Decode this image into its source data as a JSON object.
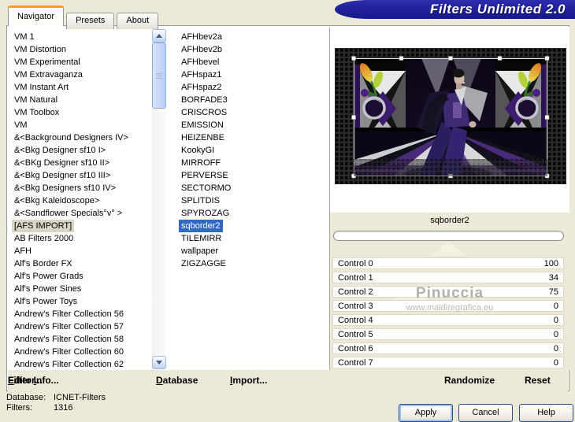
{
  "window": {
    "title": "Filters Unlimited 2.0"
  },
  "tabs": {
    "items": [
      "Navigator",
      "Presets",
      "About"
    ],
    "selected_index": 0
  },
  "category_list": {
    "selected_index": 15,
    "items": [
      "VM 1",
      "VM Distortion",
      "VM Experimental",
      "VM Extravaganza",
      "VM Instant Art",
      "VM Natural",
      "VM Toolbox",
      "VM",
      "&<Background Designers IV>",
      "&<Bkg Designer sf10 I>",
      "&<BKg Designer sf10 II>",
      "&<Bkg Designer sf10 III>",
      "&<Bkg Designers sf10 IV>",
      "&<Bkg Kaleidoscope>",
      "&<Sandflower Specials°v° >",
      "[AFS IMPORT]",
      "AB Filters 2000",
      "AFH",
      "Alf's Border FX",
      "Alf's Power Grads",
      "Alf's Power Sines",
      "Alf's Power Toys",
      "Andrew's Filter Collection 56",
      "Andrew's Filter Collection 57",
      "Andrew's Filter Collection 58",
      "Andrew's Filter Collection 60",
      "Andrew's Filter Collection 62"
    ]
  },
  "filter_list": {
    "selected_index": 15,
    "items": [
      "AFHbev2a",
      "AFHbev2b",
      "AFHbevel",
      "AFHspaz1",
      "AFHspaz2",
      "BORFADE3",
      "CRISCROS",
      "EMISSION",
      "HEIZENBE",
      "KookyGI",
      "MIRROFF",
      "PERVERSE",
      "SECTORMO",
      "SPLITDIS",
      "SPYROZAG",
      "sqborder2",
      "TILEMIRR",
      "wallpaper",
      "ZIGZAGGE"
    ]
  },
  "preview": {
    "filter_name": "sqborder2"
  },
  "controls": [
    {
      "label": "Control 0",
      "value": "100"
    },
    {
      "label": "Control 1",
      "value": "34"
    },
    {
      "label": "Control 2",
      "value": "75"
    },
    {
      "label": "Control 3",
      "value": "0"
    },
    {
      "label": "Control 4",
      "value": "0"
    },
    {
      "label": "Control 5",
      "value": "0"
    },
    {
      "label": "Control 6",
      "value": "0"
    },
    {
      "label": "Control 7",
      "value": "0"
    }
  ],
  "watermark": {
    "line1": "Pinuccia",
    "line2": "www.maidiregrafica.eu"
  },
  "toolbar": {
    "items": [
      {
        "pre": "",
        "key": "D",
        "post": "atabase"
      },
      {
        "pre": "",
        "key": "I",
        "post": "mport..."
      },
      {
        "pre": "Filter ",
        "key": "I",
        "post": "nfo..."
      },
      {
        "pre": "",
        "key": "E",
        "post": "ditor..."
      }
    ],
    "randomize_label": "Randomize",
    "reset_label": "Reset"
  },
  "status": {
    "rows": [
      {
        "label": "Database:",
        "value": "ICNET-Filters"
      },
      {
        "label": "Filters:",
        "value": "1316"
      }
    ]
  },
  "actions": {
    "apply": "Apply",
    "cancel": "Cancel",
    "help": "Help"
  },
  "colors": {
    "dialog_beige": "#ece9d8",
    "banner_navy": "#20209a",
    "selection_blue": "#316ac5",
    "inactive_selection": "#d9d5c5",
    "tab_accent_orange": "#f0a029"
  }
}
